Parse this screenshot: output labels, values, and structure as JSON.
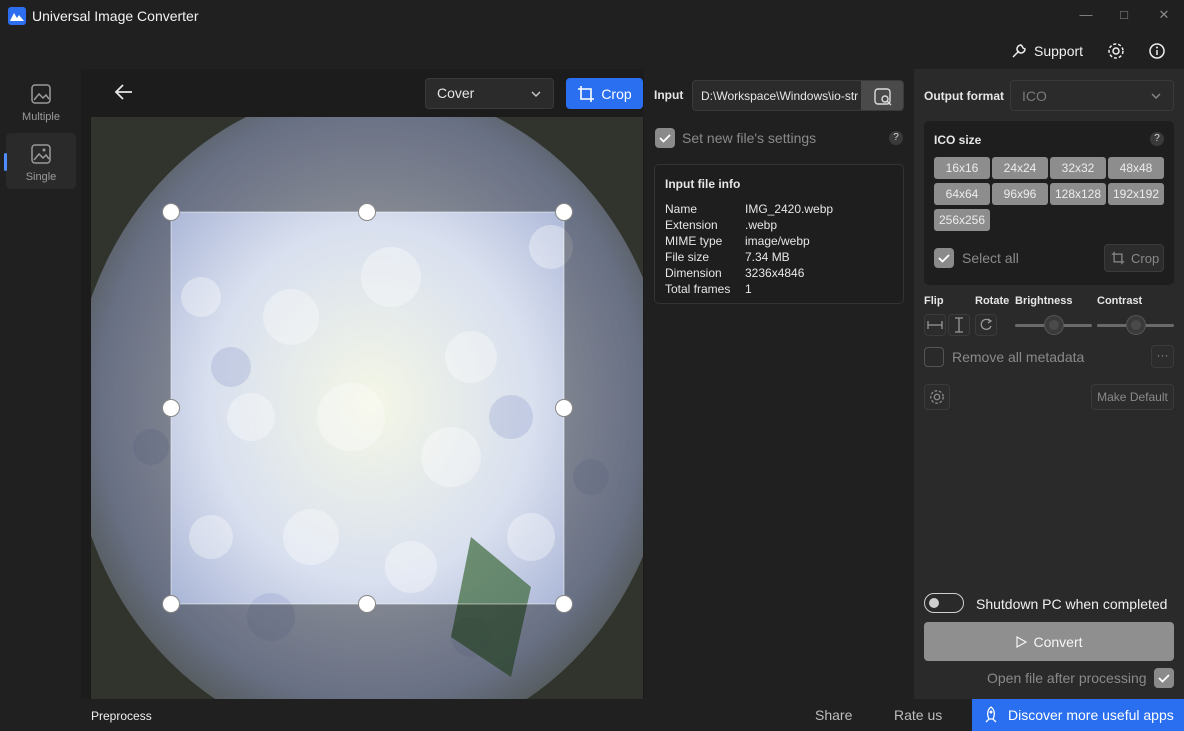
{
  "app": {
    "title": "Universal Image Converter"
  },
  "topbar": {
    "support_label": "Support"
  },
  "sidebar": {
    "items": [
      {
        "label": "Multiple"
      },
      {
        "label": "Single"
      }
    ]
  },
  "toolbar": {
    "fit_mode": "Cover",
    "crop_label": "Crop"
  },
  "input": {
    "label": "Input",
    "path": "D:\\Workspace\\Windows\\io-str",
    "new_settings_label": "Set new file's settings",
    "help": "?"
  },
  "file_info": {
    "title": "Input file info",
    "rows": [
      {
        "key": "Name",
        "value": "IMG_2420.webp"
      },
      {
        "key": "Extension",
        "value": ".webp"
      },
      {
        "key": "MIME type",
        "value": "image/webp"
      },
      {
        "key": "File size",
        "value": "7.34 MB"
      },
      {
        "key": "Dimension",
        "value": "3236x4846"
      },
      {
        "key": "Total frames",
        "value": "1"
      }
    ]
  },
  "output": {
    "label": "Output format",
    "format": "ICO",
    "ico_title": "ICO size",
    "help": "?",
    "sizes": [
      "16x16",
      "24x24",
      "32x32",
      "48x48",
      "64x64",
      "96x96",
      "128x128",
      "192x192",
      "256x256"
    ],
    "select_all_label": "Select all",
    "crop_label": "Crop"
  },
  "adjust": {
    "flip_label": "Flip",
    "rotate_label": "Rotate",
    "brightness_label": "Brightness",
    "contrast_label": "Contrast",
    "brightness_value": 0.5,
    "contrast_value": 0.5,
    "metadata_label": "Remove all metadata",
    "more_label": "···",
    "make_default_label": "Make Default"
  },
  "footer_actions": {
    "shutdown_label": "Shutdown PC when completed",
    "convert_label": "Convert",
    "open_after_label": "Open file after processing"
  },
  "statusbar": {
    "preprocess_label": "Preprocess",
    "share_label": "Share",
    "rate_label": "Rate us",
    "discover_label": "Discover more useful apps"
  },
  "colors": {
    "accent": "#2a6ff0"
  }
}
